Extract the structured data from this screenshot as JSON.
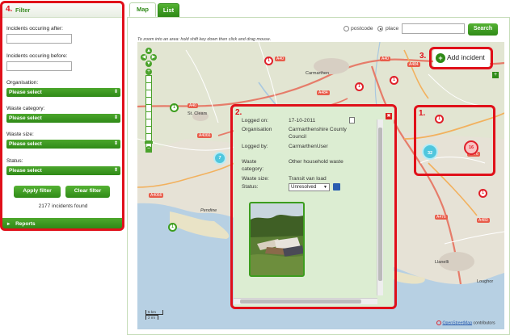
{
  "filter": {
    "annotation": "4.",
    "title": "Filter",
    "after_label": "Incidents occuring after:",
    "before_label": "Incidents occuring before:",
    "organisation_label": "Organisation:",
    "organisation_value": "Please select",
    "waste_category_label": "Waste category:",
    "waste_category_value": "Please select",
    "waste_size_label": "Waste size:",
    "waste_size_value": "Please select",
    "status_label": "Status:",
    "status_value": "Please select",
    "apply_label": "Apply filter",
    "clear_label": "Clear filter",
    "incidents_found": "2177 incidents found",
    "reports_label": "Reports"
  },
  "tabs": [
    {
      "label": "Map",
      "active": true
    },
    {
      "label": "List",
      "active": false
    }
  ],
  "search": {
    "postcode_label": "postcode",
    "place_label": "place",
    "selected": "place",
    "place_value": "",
    "search_label": "Search",
    "zoom_hint": "To zoom into an area: hold shift key down then click and drag mouse."
  },
  "map": {
    "places": [
      "Carmarthen",
      "St. Clears",
      "Llanelli",
      "Loughor",
      "Pendine"
    ],
    "roads": [
      "A40",
      "A40",
      "A40",
      "A484",
      "A4066",
      "A4066",
      "A476",
      "A476",
      "A484",
      "A483"
    ],
    "markers": [
      {
        "kind": "red",
        "label": "1"
      },
      {
        "kind": "red",
        "label": "1"
      },
      {
        "kind": "red",
        "label": "1"
      },
      {
        "kind": "red",
        "label": "1"
      },
      {
        "kind": "red",
        "label": "1"
      },
      {
        "kind": "green",
        "label": "1"
      },
      {
        "kind": "green",
        "label": "1"
      },
      {
        "kind": "cluster-red",
        "label": "16"
      },
      {
        "kind": "cluster-cyan",
        "label": "32"
      },
      {
        "kind": "cluster-cyan",
        "label": "7"
      }
    ],
    "scale_km": "5 km",
    "scale_mi": "2 mi",
    "attribution_link": "OpenStreetMap",
    "attribution_text": "contributors"
  },
  "annotations": {
    "popup": "2.",
    "cluster_area": "1.",
    "add_incident": "3."
  },
  "add_incident": {
    "label": "Add incident",
    "icon": "plus-icon"
  },
  "popup": {
    "logged_on_label": "Logged on:",
    "logged_on_value": "17-10-2011",
    "organisation_label": "Organisation",
    "organisation_value_line1": "Carmarthenshire County",
    "organisation_value_line2": "Council",
    "logged_by_label": "Logged by:",
    "logged_by_value": "CarmarthenUser",
    "waste_category_label_line1": "Waste",
    "waste_category_label_line2": "category:",
    "waste_category_value": "Other household waste",
    "waste_size_label": "Waste size:",
    "waste_size_value": "Transit van load",
    "status_label": "Status:",
    "status_value": "Unresolved",
    "icons": [
      "document-icon",
      "save-icon",
      "close-icon"
    ]
  },
  "colors": {
    "accent_green": "#2f8a17",
    "annotation_red": "#e0101a",
    "popup_bg": "#dcedd2",
    "cluster_cyan": "#4fc6dd"
  }
}
